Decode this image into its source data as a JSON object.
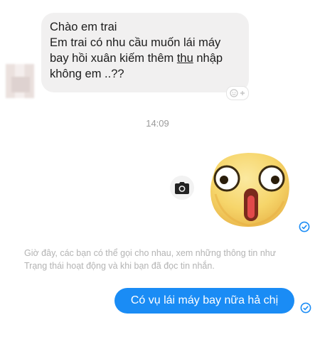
{
  "incoming_message": {
    "line1": "Chào em trai",
    "line2": "Em trai có nhu cầu muốn lái máy",
    "line3_before": "bay hồi xuân kiếm thêm ",
    "line3_underlined": "thu",
    "line3_after": " nhập",
    "line4": "không em ..??"
  },
  "timestamp": "14:09",
  "notice_text": "Giờ đây, các bạn có thể gọi cho nhau, xem những thông tin như Trạng thái hoạt động và khi bạn đã đọc tin nhắn.",
  "outgoing_message": "Có vụ lái máy bay nữa hả chị",
  "icons": {
    "camera": "camera-icon",
    "react": "add-reaction-icon",
    "sent": "sent-check-icon",
    "sticker": "shocked-face-sticker"
  },
  "colors": {
    "outgoing_bubble": "#1a8cf5",
    "incoming_bubble": "#f1f0f0",
    "check": "#1a8cf5"
  }
}
